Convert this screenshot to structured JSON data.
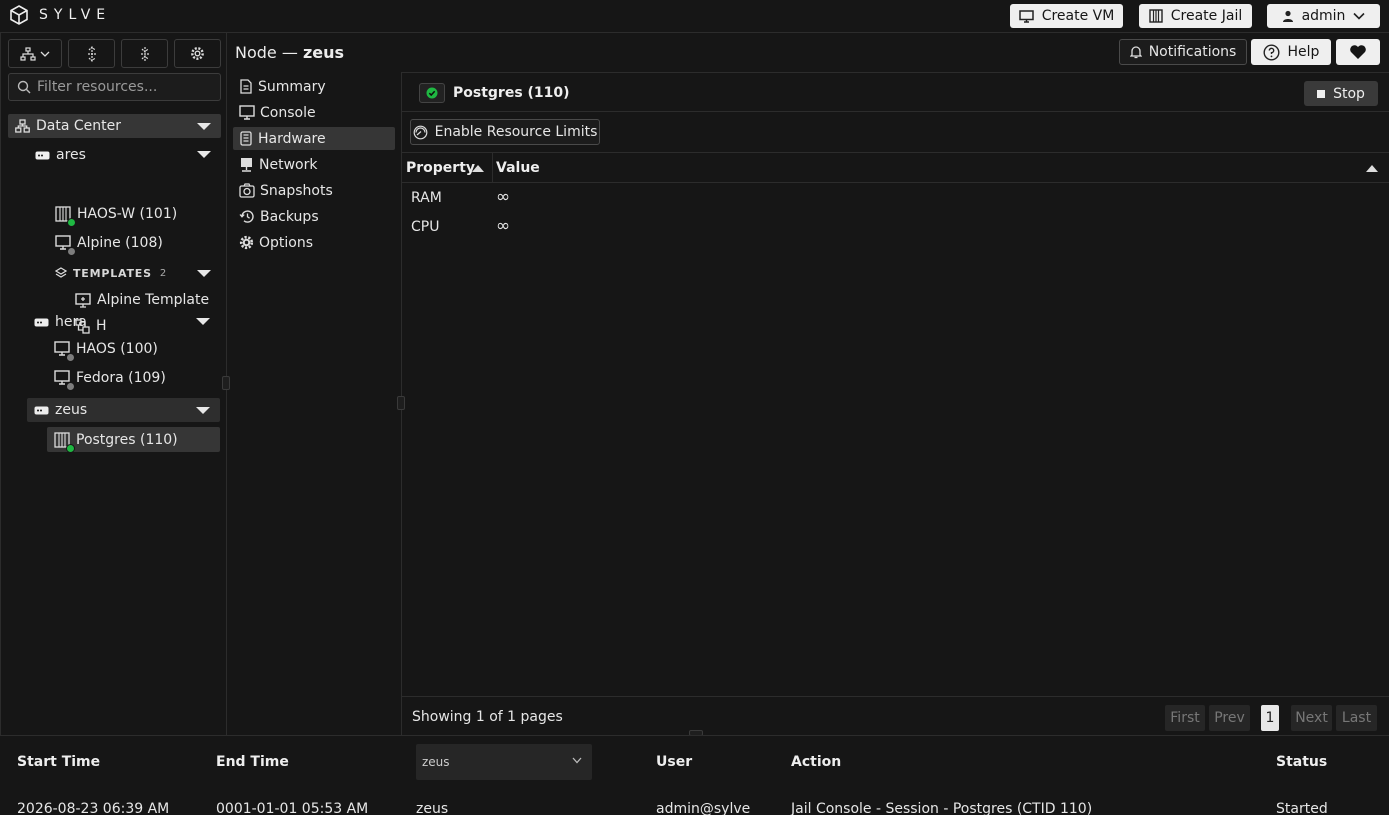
{
  "app": {
    "brand": "SYLVE"
  },
  "topbar": {
    "create_vm": "Create VM",
    "create_jail": "Create Jail",
    "user": "admin",
    "notifications": "Notifications",
    "help": "Help"
  },
  "sidebar": {
    "filter_placeholder": "Filter resources...",
    "datacenter": "Data Center",
    "nodes": {
      "ares": "ares",
      "ares_children": [
        "HAOS-W (101)",
        "Alpine (108)"
      ],
      "templates_label": "TEMPLATES",
      "templates_count": "2",
      "templates": [
        "Alpine Template",
        "H"
      ],
      "hera": "hera",
      "hera_children": [
        "HAOS (100)",
        "Fedora (109)"
      ],
      "zeus": "zeus",
      "zeus_children": [
        "Postgres (110)"
      ]
    }
  },
  "node_header": {
    "prefix": "Node —",
    "name": "zeus"
  },
  "nav": {
    "items": [
      "Summary",
      "Console",
      "Hardware",
      "Network",
      "Snapshots",
      "Backups",
      "Options"
    ],
    "active": "Hardware"
  },
  "main": {
    "title": "Postgres (110)",
    "stop_label": "Stop",
    "enable_limits": "Enable Resource Limits",
    "columns": [
      "Property",
      "Value"
    ],
    "rows": [
      {
        "property": "RAM",
        "value": "∞"
      },
      {
        "property": "CPU",
        "value": "∞"
      }
    ],
    "pagination": {
      "summary": "Showing 1 of 1 pages",
      "first": "First",
      "prev": "Prev",
      "current": "1",
      "next": "Next",
      "last": "Last"
    }
  },
  "log": {
    "columns": {
      "start": "Start Time",
      "end": "End Time",
      "user": "User",
      "action": "Action",
      "status": "Status"
    },
    "node_filter": "zeus",
    "row": {
      "start": "2026-08-23 06:39 AM",
      "end": "0001-01-01 05:53 AM",
      "node": "zeus",
      "user": "admin@sylve",
      "action": "Jail Console - Session - Postgres (CTID 110)",
      "status": "Started"
    }
  },
  "colors": {
    "background": "#161616",
    "running": "#1fb842",
    "stopped": "#7d7d7d",
    "selected": "#363636"
  },
  "icons": [
    "cube-logo-icon",
    "monitor-icon",
    "jail-icon",
    "user-icon",
    "chevron-down-icon",
    "bell-icon",
    "help-icon",
    "heart-icon",
    "tree-icon",
    "expand-icon",
    "collapse-icon",
    "gear-icon",
    "search-icon",
    "datacenter-icon",
    "server-icon",
    "layers-icon",
    "file-icon",
    "hard-drive-icon",
    "network-icon",
    "camera-icon",
    "history-icon",
    "gauge-icon",
    "check-icon",
    "stop-icon"
  ]
}
